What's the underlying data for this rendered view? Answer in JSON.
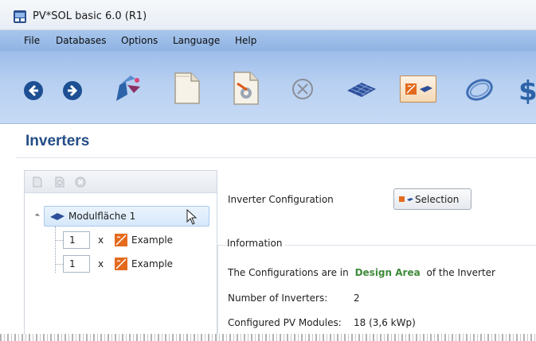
{
  "window": {
    "title": "PV*SOL basic 6.0 (R1)"
  },
  "menu": {
    "items": [
      "File",
      "Databases",
      "Options",
      "Language",
      "Help"
    ]
  },
  "toolbar": {
    "tools": [
      "back-icon",
      "forward-icon",
      "pv-module-wizard-icon",
      "document-icon",
      "settings-document-icon",
      "cancel-icon",
      "pv-module-icon",
      "inverter-icon",
      "cable-icon",
      "financial-icon"
    ],
    "active_tool": "inverter-icon",
    "colors": {
      "accent": "#234d86",
      "active_border": "#c58b4b"
    }
  },
  "page": {
    "title": "Inverters"
  },
  "tree": {
    "root": {
      "label": "Modulfläche 1"
    },
    "children": [
      {
        "quantity": "1",
        "times": "x",
        "label": "Example"
      },
      {
        "quantity": "1",
        "times": "x",
        "label": "Example"
      }
    ]
  },
  "config": {
    "label": "Inverter Configuration",
    "button_label": "Selection"
  },
  "info": {
    "legend": "Information",
    "configs_prefix": "The Configurations are in",
    "design_area": "Design Area",
    "configs_suffix": "of the Inverter",
    "num_inverters_label": "Number of Inverters:",
    "num_inverters_value": "2",
    "modules_label": "Configured PV Modules:",
    "modules_value": "18 (3,6 kWp)",
    "colors": {
      "design_area": "#3f8a3a"
    }
  }
}
